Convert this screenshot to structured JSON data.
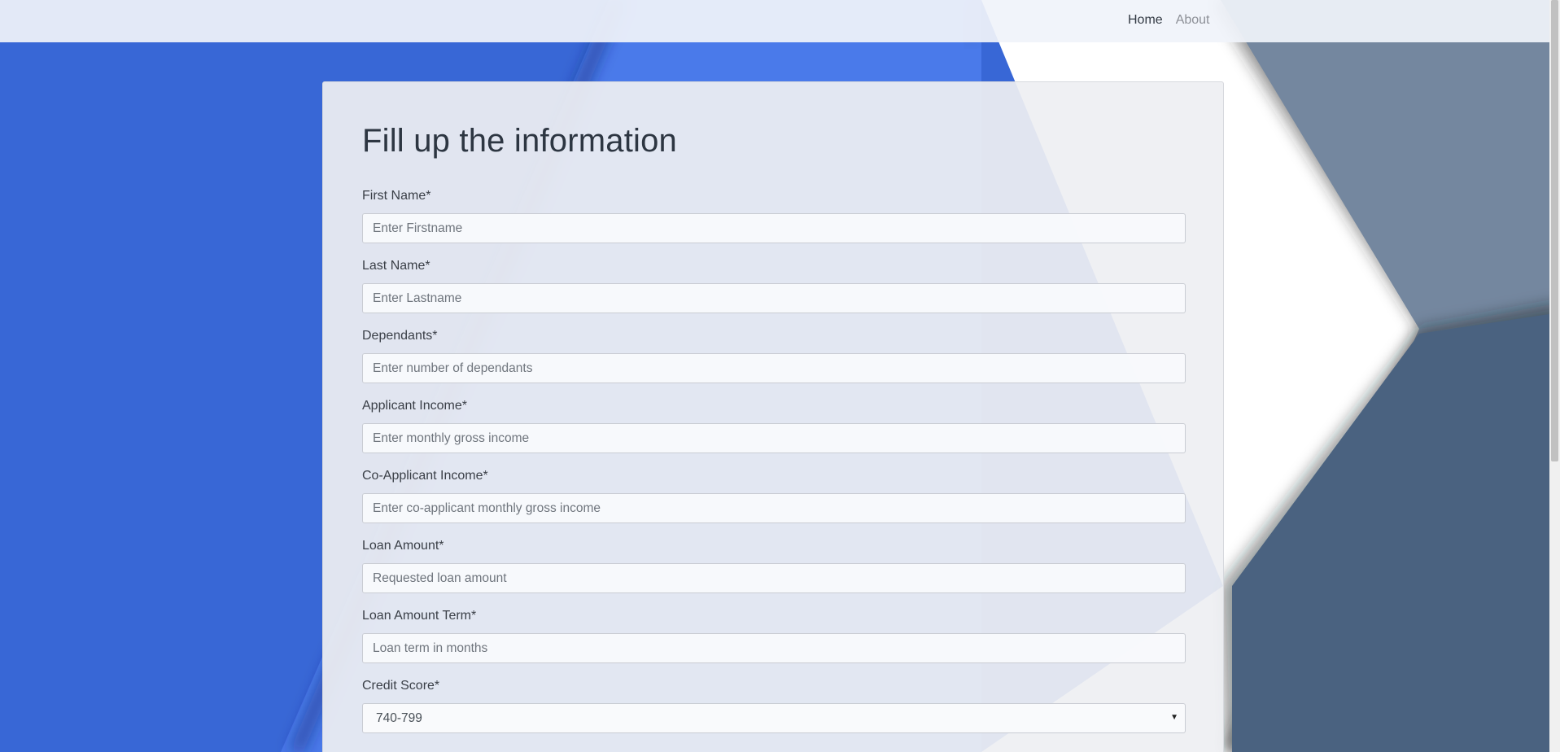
{
  "nav": {
    "links": [
      {
        "label": "Home",
        "active": true
      },
      {
        "label": "About",
        "active": false
      }
    ]
  },
  "form": {
    "title": "Fill up the information",
    "fields": [
      {
        "label": "First Name*",
        "placeholder": "Enter Firstname"
      },
      {
        "label": "Last Name*",
        "placeholder": "Enter Lastname"
      },
      {
        "label": "Dependants*",
        "placeholder": "Enter number of dependants"
      },
      {
        "label": "Applicant Income*",
        "placeholder": "Enter monthly gross income"
      },
      {
        "label": "Co-Applicant Income*",
        "placeholder": "Enter co-applicant monthly gross income"
      },
      {
        "label": "Loan Amount*",
        "placeholder": "Requested loan amount"
      },
      {
        "label": "Loan Amount Term*",
        "placeholder": "Loan term in months"
      }
    ],
    "credit_score": {
      "label": "Credit Score*",
      "selected": "740-799"
    }
  },
  "colors": {
    "bg_blue": "#3867d6",
    "bg_light_blue": "#4a7aea",
    "bg_slate": "#74879f",
    "bg_dark_slate": "#4a6280",
    "card_bg": "#eeeff2"
  }
}
